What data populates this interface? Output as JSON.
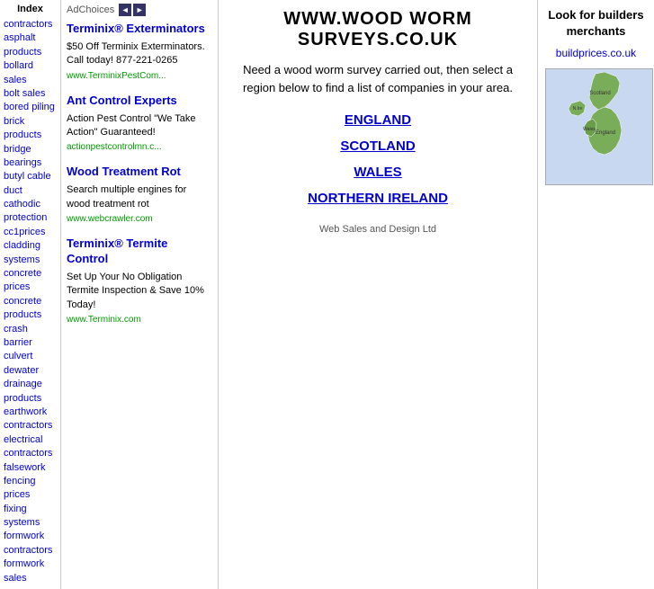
{
  "sidebar": {
    "index_label": "Index",
    "links": [
      {
        "label": "contractors",
        "href": "#"
      },
      {
        "label": "asphalt products",
        "href": "#"
      },
      {
        "label": "bollard sales",
        "href": "#"
      },
      {
        "label": "bolt sales",
        "href": "#"
      },
      {
        "label": "bored piling",
        "href": "#"
      },
      {
        "label": "brick products",
        "href": "#"
      },
      {
        "label": "bridge bearings",
        "href": "#"
      },
      {
        "label": "butyl cable duct",
        "href": "#"
      },
      {
        "label": "cathodic protection",
        "href": "#"
      },
      {
        "label": "cc1prices",
        "href": "#"
      },
      {
        "label": "cladding systems",
        "href": "#"
      },
      {
        "label": "concrete prices",
        "href": "#"
      },
      {
        "label": "concrete products",
        "href": "#"
      },
      {
        "label": "crash barrier",
        "href": "#"
      },
      {
        "label": "culvert",
        "href": "#"
      },
      {
        "label": "dewater",
        "href": "#"
      },
      {
        "label": "drainage products",
        "href": "#"
      },
      {
        "label": "earthwork contractors",
        "href": "#"
      },
      {
        "label": "electrical contractors",
        "href": "#"
      },
      {
        "label": "falsework",
        "href": "#"
      },
      {
        "label": "fencing prices",
        "href": "#"
      },
      {
        "label": "fixing systems",
        "href": "#"
      },
      {
        "label": "formwork contractors",
        "href": "#"
      },
      {
        "label": "formwork sales",
        "href": "#"
      }
    ]
  },
  "adChoices": {
    "label": "AdChoices",
    "prev_label": "◄",
    "next_label": "►"
  },
  "ads": [
    {
      "title": "Terminix® Exterminators",
      "body": "$50 Off Terminix Exterminators. Call today! 877-221-0265",
      "url": "www.TerminixPestCom..."
    },
    {
      "title": "Ant Control Experts",
      "body": "Action Pest Control \"We Take Action\" Guaranteed!",
      "url": "actionpestcontrolmn.c..."
    },
    {
      "title": "Wood Treatment Rot",
      "body": "Search multiple engines for wood treatment rot",
      "url": "www.webcrawler.com"
    },
    {
      "title": "Terminix® Termite Control",
      "body": "Set Up Your No Obligation Termite Inspection & Save 10% Today!",
      "url": "www.Terminix.com"
    }
  ],
  "main": {
    "title": "WWW.WOOD WORM SURVEYS.CO.UK",
    "description": "Need a wood worm survey carried out, then select a region below to find a list of companies in your area.",
    "regions": [
      "ENGLAND",
      "SCOTLAND",
      "WALES",
      "NORTHERN IRELAND"
    ],
    "footer": "Web Sales and Design Ltd"
  },
  "right": {
    "title": "Look for builders merchants",
    "link_text": "buildprices.co.uk",
    "link_href": "#"
  },
  "map": {
    "labels": [
      "Scotland",
      "N.Ireland",
      "Wales",
      "England"
    ]
  }
}
